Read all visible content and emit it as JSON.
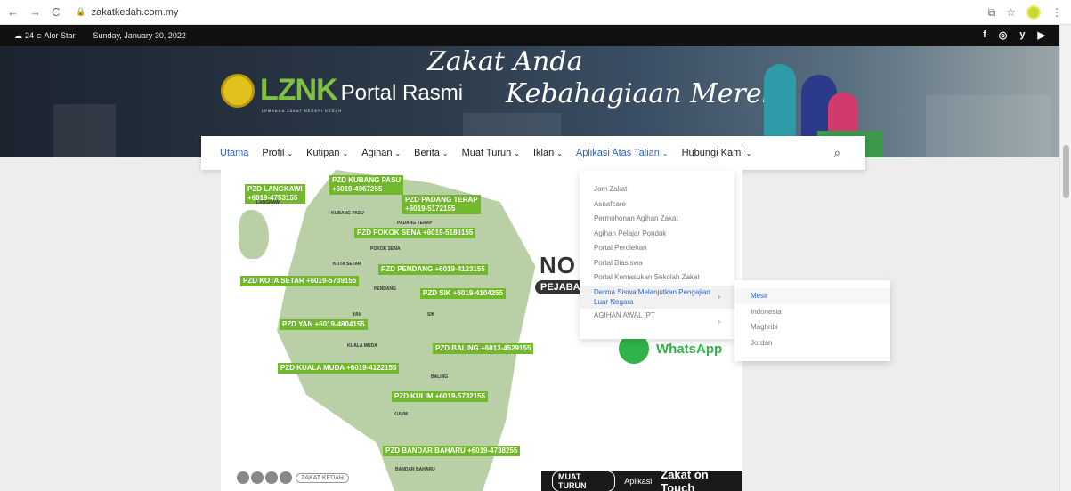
{
  "browser": {
    "back": "←",
    "forward": "→",
    "reload": "C",
    "url": "zakatkedah.com.my"
  },
  "topbar": {
    "temp": "24",
    "unit": "C",
    "city": "Alor Star",
    "date": "Sunday, January 30, 2022",
    "social": [
      "f",
      "◎",
      "y",
      "▶"
    ]
  },
  "header": {
    "logo_text": "LZNK",
    "logo_sub": "LEMBAGA ZAKAT NEGERI KEDAH",
    "portal": "Portal Rasmi",
    "tagline_1": "Zakat Anda",
    "tagline_2": "Kebahagiaan Mereka"
  },
  "menu": {
    "items": [
      {
        "label": "Utama",
        "chev": ""
      },
      {
        "label": "Profil",
        "chev": "⌄"
      },
      {
        "label": "Kutipan",
        "chev": "⌄"
      },
      {
        "label": "Agihan",
        "chev": "⌄"
      },
      {
        "label": "Berita",
        "chev": "⌄"
      },
      {
        "label": "Muat Turun",
        "chev": "⌄"
      },
      {
        "label": "Iklan",
        "chev": "⌄"
      },
      {
        "label": "Aplikasi Atas Talian",
        "chev": "⌄"
      },
      {
        "label": "Hubungi Kami",
        "chev": "⌄"
      }
    ]
  },
  "dropdown": {
    "items": [
      "Jom Zakat",
      "Asnafcare",
      "Permohonan Agihan Zakat",
      "Agihan Pelajar Pondok",
      "Portal Perolehan",
      "Portal Biasiswa",
      "Portal Kemasukan Sekolah Zakat",
      "Derma Siswa Melanjutkan Pengajian Luar Negara",
      "AGIHAN AWAL IPT"
    ],
    "arrow": "›"
  },
  "submenu": {
    "items": [
      "Mesir",
      "Indonesia",
      "Maghribi",
      "Jordan"
    ]
  },
  "poster": {
    "labels": [
      {
        "name": "PZD LANGKAWI",
        "phone": "+6019-4753155"
      },
      {
        "name": "PZD KUBANG PASU",
        "phone": "+6019-4967255"
      },
      {
        "name": "PZD PADANG TERAP",
        "phone": "+6019-5172155"
      },
      {
        "name": "PZD POKOK SENA",
        "phone": "+6019-5186155"
      },
      {
        "name": "PZD PENDANG",
        "phone": "+6019-4123155"
      },
      {
        "name": "PZD KOTA SETAR",
        "phone": "+6019-5739155"
      },
      {
        "name": "PZD SIK",
        "phone": "+6019-4104255"
      },
      {
        "name": "PZD YAN",
        "phone": "+6019-4804155"
      },
      {
        "name": "PZD BALING",
        "phone": "+6013-4529155"
      },
      {
        "name": "PZD KUALA MUDA",
        "phone": "+6019-4122155"
      },
      {
        "name": "PZD KULIM",
        "phone": "+6019-5732155"
      },
      {
        "name": "PZD BANDAR BAHARU",
        "phone": "+6019-4738255"
      }
    ],
    "towns": [
      "LANGKAWI",
      "KUBANG PASU",
      "PADANG TERAP",
      "POKOK SENA",
      "KOTA SETAR",
      "PENDANG",
      "SIK",
      "YAN",
      "KUALA MUDA",
      "BALING",
      "KULIM",
      "BANDAR BAHARU"
    ],
    "notice": "NO",
    "pejabat": "PEJABA",
    "whatsapp": "WhatsApp",
    "social_tag": "ZAKAT KEDAH",
    "muat_btn": "MUAT TURUN",
    "aplikasi": "Aplikasi",
    "zakat_touch": "Zakat on Touch"
  }
}
